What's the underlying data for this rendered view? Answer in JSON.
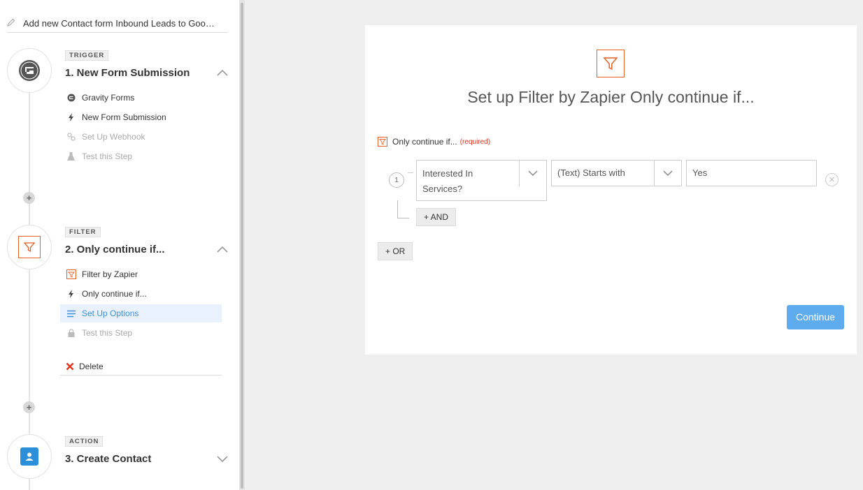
{
  "zap_title": "Add new Contact form Inbound Leads to Goo…",
  "steps": [
    {
      "tag": "TRIGGER",
      "title": "1. New Form Submission",
      "items": [
        {
          "label": "Gravity Forms",
          "icon": "gravity-forms-icon",
          "state": "normal"
        },
        {
          "label": "New Form Submission",
          "icon": "bolt-icon",
          "state": "normal"
        },
        {
          "label": "Set Up Webhook",
          "icon": "link-icon",
          "state": "muted"
        },
        {
          "label": "Test this Step",
          "icon": "flask-icon",
          "state": "muted"
        }
      ]
    },
    {
      "tag": "FILTER",
      "title": "2. Only continue if...",
      "items": [
        {
          "label": "Filter by Zapier",
          "icon": "filter-icon",
          "state": "normal"
        },
        {
          "label": "Only continue if...",
          "icon": "bolt-icon",
          "state": "normal"
        },
        {
          "label": "Set Up Options",
          "icon": "list-icon",
          "state": "active"
        },
        {
          "label": "Test this Step",
          "icon": "lock-icon",
          "state": "muted"
        }
      ],
      "delete_label": "Delete"
    },
    {
      "tag": "ACTION",
      "title": "3. Create Contact"
    }
  ],
  "main": {
    "heading": "Set up Filter by Zapier Only continue if...",
    "filter_label": "Only continue if...",
    "required_label": "(required)",
    "rule_number": "1",
    "field_value": "Interested In Services?",
    "condition_value": "(Text) Starts with",
    "input_value": "Yes",
    "and_button": "+ AND",
    "or_button": "+ OR",
    "continue_button": "Continue"
  },
  "colors": {
    "accent_orange": "#e65f23",
    "continue_blue": "#5eabee",
    "active_blue": "#3f8ed9",
    "delete_red": "#e0321c"
  }
}
